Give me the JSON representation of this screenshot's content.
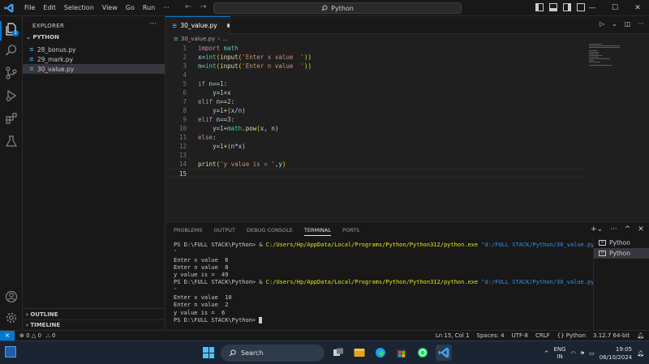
{
  "titlebar": {
    "menu": [
      "File",
      "Edit",
      "Selection",
      "View",
      "Go",
      "Run",
      "···"
    ],
    "search_text": "Python",
    "window_controls": [
      "—",
      "☐",
      "✕"
    ]
  },
  "activity": {
    "explorer_badge": "1",
    "icons": [
      "files-icon",
      "search-icon",
      "source-control-icon",
      "run-debug-icon",
      "extensions-icon",
      "testing-icon"
    ],
    "bottom_icons": [
      "account-icon",
      "settings-icon"
    ]
  },
  "sidebar": {
    "title": "EXPLORER",
    "more": "···",
    "folder": "PYTHON",
    "files": [
      {
        "name": "28_bonus.py",
        "selected": false
      },
      {
        "name": "29_mark.py",
        "selected": false
      },
      {
        "name": "30_value.py",
        "selected": true
      }
    ],
    "sections": [
      "OUTLINE",
      "TIMELINE"
    ]
  },
  "editor": {
    "tab_label": "30_value.py",
    "breadcrumb_file": "30_value.py",
    "breadcrumb_more": "…",
    "lines": [
      {
        "n": "1"
      },
      {
        "n": "2"
      },
      {
        "n": "3"
      },
      {
        "n": "4"
      },
      {
        "n": "5"
      },
      {
        "n": "6"
      },
      {
        "n": "7"
      },
      {
        "n": "8"
      },
      {
        "n": "9"
      },
      {
        "n": "10"
      },
      {
        "n": "11"
      },
      {
        "n": "12"
      },
      {
        "n": "13"
      },
      {
        "n": "14"
      },
      {
        "n": "15"
      }
    ]
  },
  "panel": {
    "tabs": [
      "PROBLEMS",
      "OUTPUT",
      "DEBUG CONSOLE",
      "TERMINAL",
      "PORTS"
    ],
    "active_tab": "TERMINAL",
    "terminal": {
      "prompt1": "PS D:\\FULL STACK\\Python> ",
      "amp": "& ",
      "exe": "C:/Users/Hp/AppData/Local/Programs/Python/Python312/python.exe",
      "script": "\"d:/FULL STACK/Python/30_value.py",
      "script_tail": "\"",
      "run1": [
        "Enter x value  6",
        "Enter n value  8",
        "y value is =  49"
      ],
      "run2": [
        "Enter x value  10",
        "Enter n value  2",
        "y value is =  6"
      ],
      "final_prompt": "PS D:\\FULL STACK\\Python> "
    },
    "terminals": [
      {
        "label": "Python",
        "selected": false
      },
      {
        "label": "Python",
        "selected": true
      }
    ]
  },
  "status": {
    "errors": "0",
    "warnings": "0",
    "ports": "0",
    "position": "Ln 15, Col 1",
    "spaces": "Spaces: 4",
    "encoding": "UTF-8",
    "eol": "CRLF",
    "language": "{} Python",
    "interpreter": "3.12.7 64-bit"
  },
  "taskbar": {
    "search_label": "Search",
    "lang_top": "ENG",
    "lang_bottom": "IN",
    "time": "19:05",
    "date": "06/10/2024"
  }
}
